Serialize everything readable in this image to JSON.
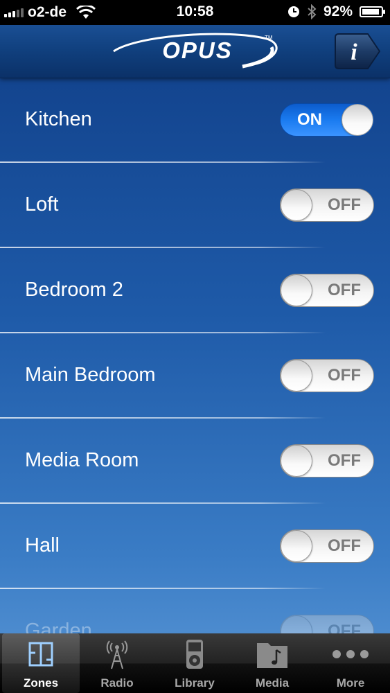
{
  "status_bar": {
    "carrier": "o2-de",
    "time": "10:58",
    "battery_percent": "92%",
    "battery_level": 0.92,
    "icons": [
      "signal-icon",
      "wifi-icon",
      "clock-icon",
      "bluetooth-icon",
      "battery-icon"
    ]
  },
  "nav": {
    "logo_text": "OPUS",
    "logo_trademark": "TM",
    "info_label": "i"
  },
  "zones": [
    {
      "name": "Kitchen",
      "state": "ON"
    },
    {
      "name": "Loft",
      "state": "OFF"
    },
    {
      "name": "Bedroom 2",
      "state": "OFF"
    },
    {
      "name": "Main Bedroom",
      "state": "OFF"
    },
    {
      "name": "Media Room",
      "state": "OFF"
    },
    {
      "name": "Hall",
      "state": "OFF"
    },
    {
      "name": "Garden",
      "state": "OFF"
    }
  ],
  "tabs": [
    {
      "label": "Zones",
      "icon": "zones-icon",
      "active": true
    },
    {
      "label": "Radio",
      "icon": "radio-tower-icon",
      "active": false
    },
    {
      "label": "Library",
      "icon": "ipod-icon",
      "active": false
    },
    {
      "label": "Media",
      "icon": "music-folder-icon",
      "active": false
    },
    {
      "label": "More",
      "icon": "more-dots-icon",
      "active": false
    }
  ],
  "colors": {
    "toggle_on": "#1a7bf0",
    "background_top": "#0f3d86",
    "background_bottom": "#5a97d6"
  }
}
